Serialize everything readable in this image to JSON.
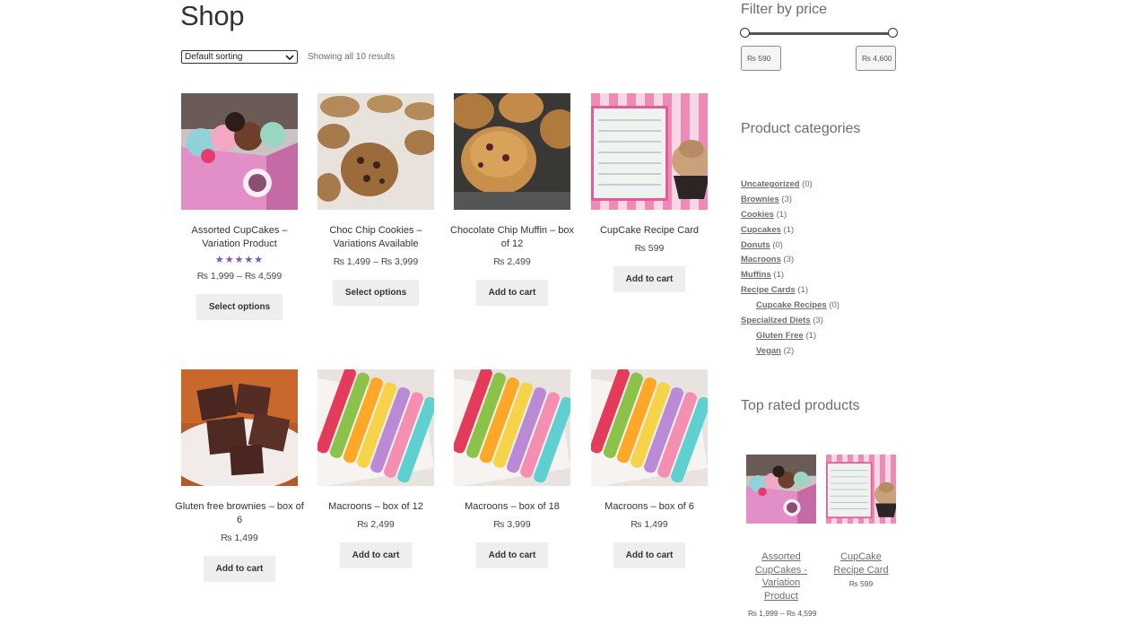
{
  "page": {
    "title": "Shop",
    "sorting": "Default sorting",
    "result_count": "Showing all 10 results"
  },
  "products": [
    {
      "name": "Assorted CupCakes – Variation Product",
      "rating": "★★★★★",
      "price": "₨ 1,999 – ₨ 4,599",
      "button": "Select options",
      "image": "cupcakes-box"
    },
    {
      "name": "Choc Chip Cookies – Variations Available",
      "price": "₨ 1,499 – ₨ 3,999",
      "button": "Select options",
      "image": "cookies"
    },
    {
      "name": "Chocolate Chip Muffin – box of 12",
      "price": "₨ 2,499",
      "button": "Add to cart",
      "image": "muffins"
    },
    {
      "name": "CupCake Recipe Card",
      "price": "₨ 599",
      "button": "Add to cart",
      "image": "recipe-card"
    },
    {
      "name": "Gluten free brownies – box of 6",
      "price": "₨ 1,499",
      "button": "Add to cart",
      "image": "brownies"
    },
    {
      "name": "Macroons – box of 12",
      "price": "₨ 2,499",
      "button": "Add to cart",
      "image": "macarons"
    },
    {
      "name": "Macroons – box of 18",
      "price": "₨ 3,999",
      "button": "Add to cart",
      "image": "macarons"
    },
    {
      "name": "Macroons – box of 6",
      "price": "₨ 1,499",
      "button": "Add to cart",
      "image": "macarons"
    }
  ],
  "sidebar": {
    "filter": {
      "title": "Filter by price",
      "min_label": "₨ 590",
      "max_label": "₨ 4,600"
    },
    "categories": {
      "title": "Product categories",
      "items": [
        {
          "label": "Uncategorized",
          "count": "(0)"
        },
        {
          "label": "Brownies",
          "count": "(3)"
        },
        {
          "label": "Cookies",
          "count": "(1)"
        },
        {
          "label": "Cupcakes",
          "count": "(1)"
        },
        {
          "label": "Donuts",
          "count": "(0)"
        },
        {
          "label": "Macroons",
          "count": "(3)"
        },
        {
          "label": "Muffins",
          "count": "(1)"
        },
        {
          "label": "Recipe Cards",
          "count": "(1)"
        },
        {
          "label": "Cupcake Recipes",
          "count": "(0)"
        },
        {
          "label": "Specialized Diets",
          "count": "(3)"
        },
        {
          "label": "Gluten Free",
          "count": "(1)"
        },
        {
          "label": "Vegan",
          "count": "(2)"
        }
      ]
    },
    "top_rated": {
      "title": "Top rated products",
      "items": [
        {
          "name": "Assorted CupCakes - Variation Product",
          "price": "₨ 1,999 – ₨ 4,599"
        },
        {
          "name": "CupCake Recipe Card",
          "price": "₨ 599"
        }
      ]
    }
  },
  "colors": {
    "accent": "#7f54b3",
    "button_bg": "#eeeeee",
    "text": "#43454b"
  }
}
